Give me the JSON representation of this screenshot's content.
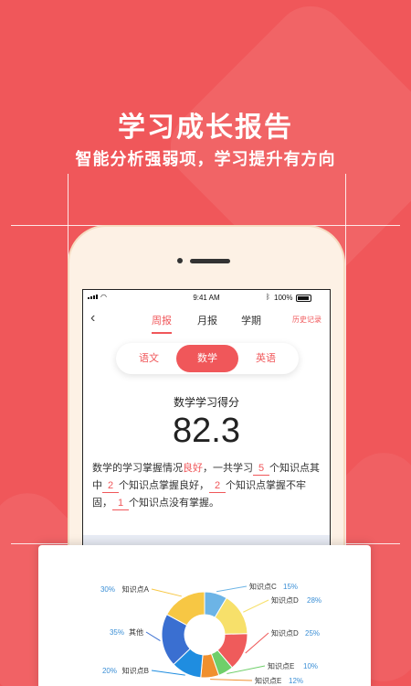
{
  "hero": {
    "title": "学习成长报告",
    "subtitle": "智能分析强弱项，学习提升有方向"
  },
  "status_bar": {
    "time": "9:41 AM",
    "battery": "100%"
  },
  "nav": {
    "back_icon": "chevron-left-icon",
    "tabs": [
      {
        "label": "周报",
        "active": true
      },
      {
        "label": "月报",
        "active": false
      },
      {
        "label": "学期",
        "active": false
      }
    ],
    "history": "历史记录"
  },
  "subjects": [
    {
      "label": "语文",
      "selected": false
    },
    {
      "label": "数学",
      "selected": true
    },
    {
      "label": "英语",
      "selected": false
    }
  ],
  "score": {
    "label": "数学学习得分",
    "value": "82.3"
  },
  "summary": {
    "p1": "数学的学习掌握情况",
    "quality": "良好",
    "p2": "，一共学习",
    "total": "5",
    "p3": "个知识点其中",
    "good": "2",
    "p4": "个知识点掌握良好，",
    "weak": "2",
    "p5": "个知识点掌握不牢固，",
    "none": "1",
    "p6": "个知识点没有掌握。"
  },
  "colors": {
    "brand": "#f0575a",
    "percent": "#3b8fd6"
  },
  "chart_data": {
    "type": "pie",
    "style": "donut",
    "slices": [
      {
        "label": "知识点C",
        "pct": "15%",
        "value": 15,
        "color": "#6cb4e6"
      },
      {
        "label": "知识点D",
        "pct": "28%",
        "value": 28,
        "color": "#f7e06a"
      },
      {
        "label": "知识点D",
        "pct": "25%",
        "value": 25,
        "color": "#ef5b5b"
      },
      {
        "label": "知识点E",
        "pct": "10%",
        "value": 10,
        "color": "#6fcf6a"
      },
      {
        "label": "知识点E",
        "pct": "12%",
        "value": 12,
        "color": "#f0902f"
      },
      {
        "label": "知识点B",
        "pct": "20%",
        "value": 20,
        "color": "#1f8de0"
      },
      {
        "label": "其他",
        "pct": "35%",
        "value": 35,
        "color": "#3a6fd1"
      },
      {
        "label": "知识点A",
        "pct": "30%",
        "value": 30,
        "color": "#f7c744"
      }
    ]
  }
}
